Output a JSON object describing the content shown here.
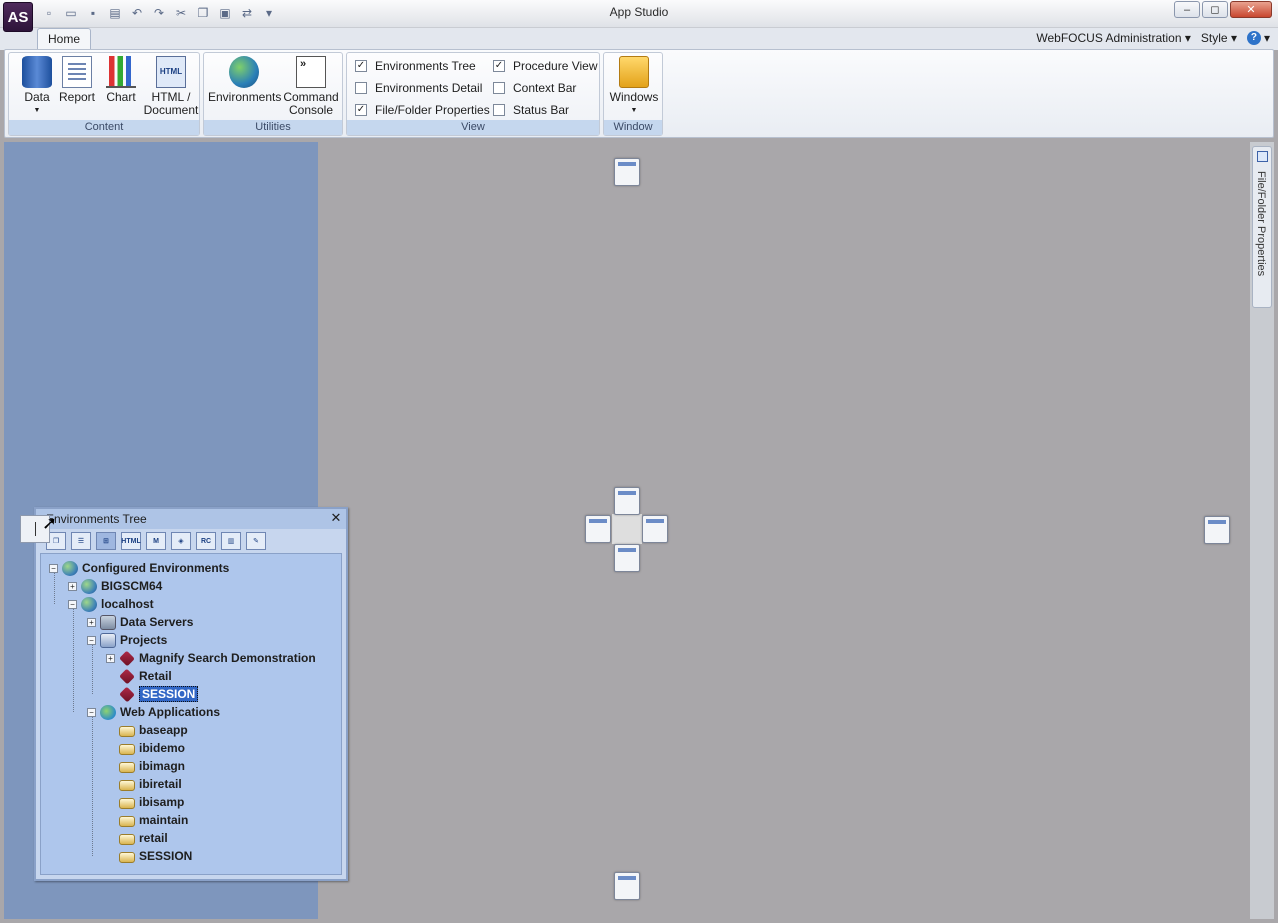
{
  "app": {
    "logo": "AS",
    "title": "App Studio"
  },
  "window_controls": {
    "minimize": "–",
    "restore": "◻",
    "close": "✕"
  },
  "qat_icons": [
    "new-icon",
    "open-icon",
    "save-icon",
    "print-icon",
    "undo-icon",
    "redo-icon",
    "cut-icon",
    "copy-icon",
    "paste-icon",
    "switch-icon",
    "dropdown-icon"
  ],
  "tabs": {
    "home": "Home"
  },
  "header_menu": {
    "admin": "WebFOCUS Administration",
    "style": "Style",
    "help": "?"
  },
  "ribbon": {
    "content": {
      "label": "Content",
      "data": "Data",
      "report": "Report",
      "chart": "Chart",
      "html_line1": "HTML /",
      "html_line2": "Document",
      "html_icon_text": "HTML"
    },
    "utilities": {
      "label": "Utilities",
      "environments": "Environments",
      "cmd_line1": "Command",
      "cmd_line2": "Console",
      "cmd_icon_text": "»"
    },
    "view": {
      "label": "View",
      "checkboxes": [
        {
          "label": "Environments Tree",
          "checked": "✓"
        },
        {
          "label": "Environments Detail",
          "checked": ""
        },
        {
          "label": "File/Folder Properties",
          "checked": "✓"
        },
        {
          "label": "Procedure View",
          "checked": "✓"
        },
        {
          "label": "Context Bar",
          "checked": ""
        },
        {
          "label": "Status Bar",
          "checked": ""
        }
      ]
    },
    "window": {
      "label": "Window",
      "windows": "Windows"
    }
  },
  "side_panel": {
    "label": "File/Folder Properties"
  },
  "env_tree": {
    "title": "Environments Tree",
    "close": "✕",
    "toolbar": [
      "copy",
      "detail",
      "tree",
      "HTML",
      "M",
      "map",
      "RC",
      "books",
      "doc"
    ],
    "nodes": {
      "root": "Configured Environments",
      "bigscm64": "BIGSCM64",
      "localhost": "localhost",
      "data_servers": "Data Servers",
      "projects": "Projects",
      "magnify": "Magnify Search Demonstration",
      "retail_proj": "Retail",
      "session_proj": "SESSION",
      "web_apps": "Web Applications",
      "folders": [
        "baseapp",
        "ibidemo",
        "ibimagn",
        "ibiretail",
        "ibisamp",
        "maintain",
        "retail",
        "SESSION"
      ]
    }
  }
}
